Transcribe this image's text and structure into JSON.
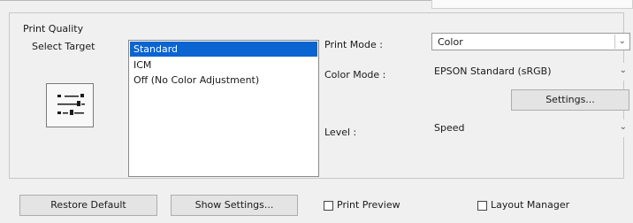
{
  "print_quality": {
    "title": "Print Quality",
    "select_target_label": "Select Target",
    "target_options": [
      "Standard",
      "ICM",
      "Off (No Color Adjustment)"
    ],
    "selected_target": "Standard"
  },
  "print_mode": {
    "label": "Print Mode :",
    "value": "Color"
  },
  "color_mode": {
    "label": "Color Mode :",
    "value": "EPSON Standard (sRGB)"
  },
  "settings_button": "Settings...",
  "level": {
    "label": "Level :",
    "value": "Speed"
  },
  "footer": {
    "restore_default": "Restore Default",
    "show_settings": "Show Settings...",
    "print_preview": "Print Preview",
    "layout_manager": "Layout Manager"
  },
  "colors": {
    "selection": "#0a64d1",
    "background": "#f0f0f0"
  },
  "icons": [
    "target-settings-icon",
    "chevron-down-icon",
    "checkbox-icon"
  ]
}
